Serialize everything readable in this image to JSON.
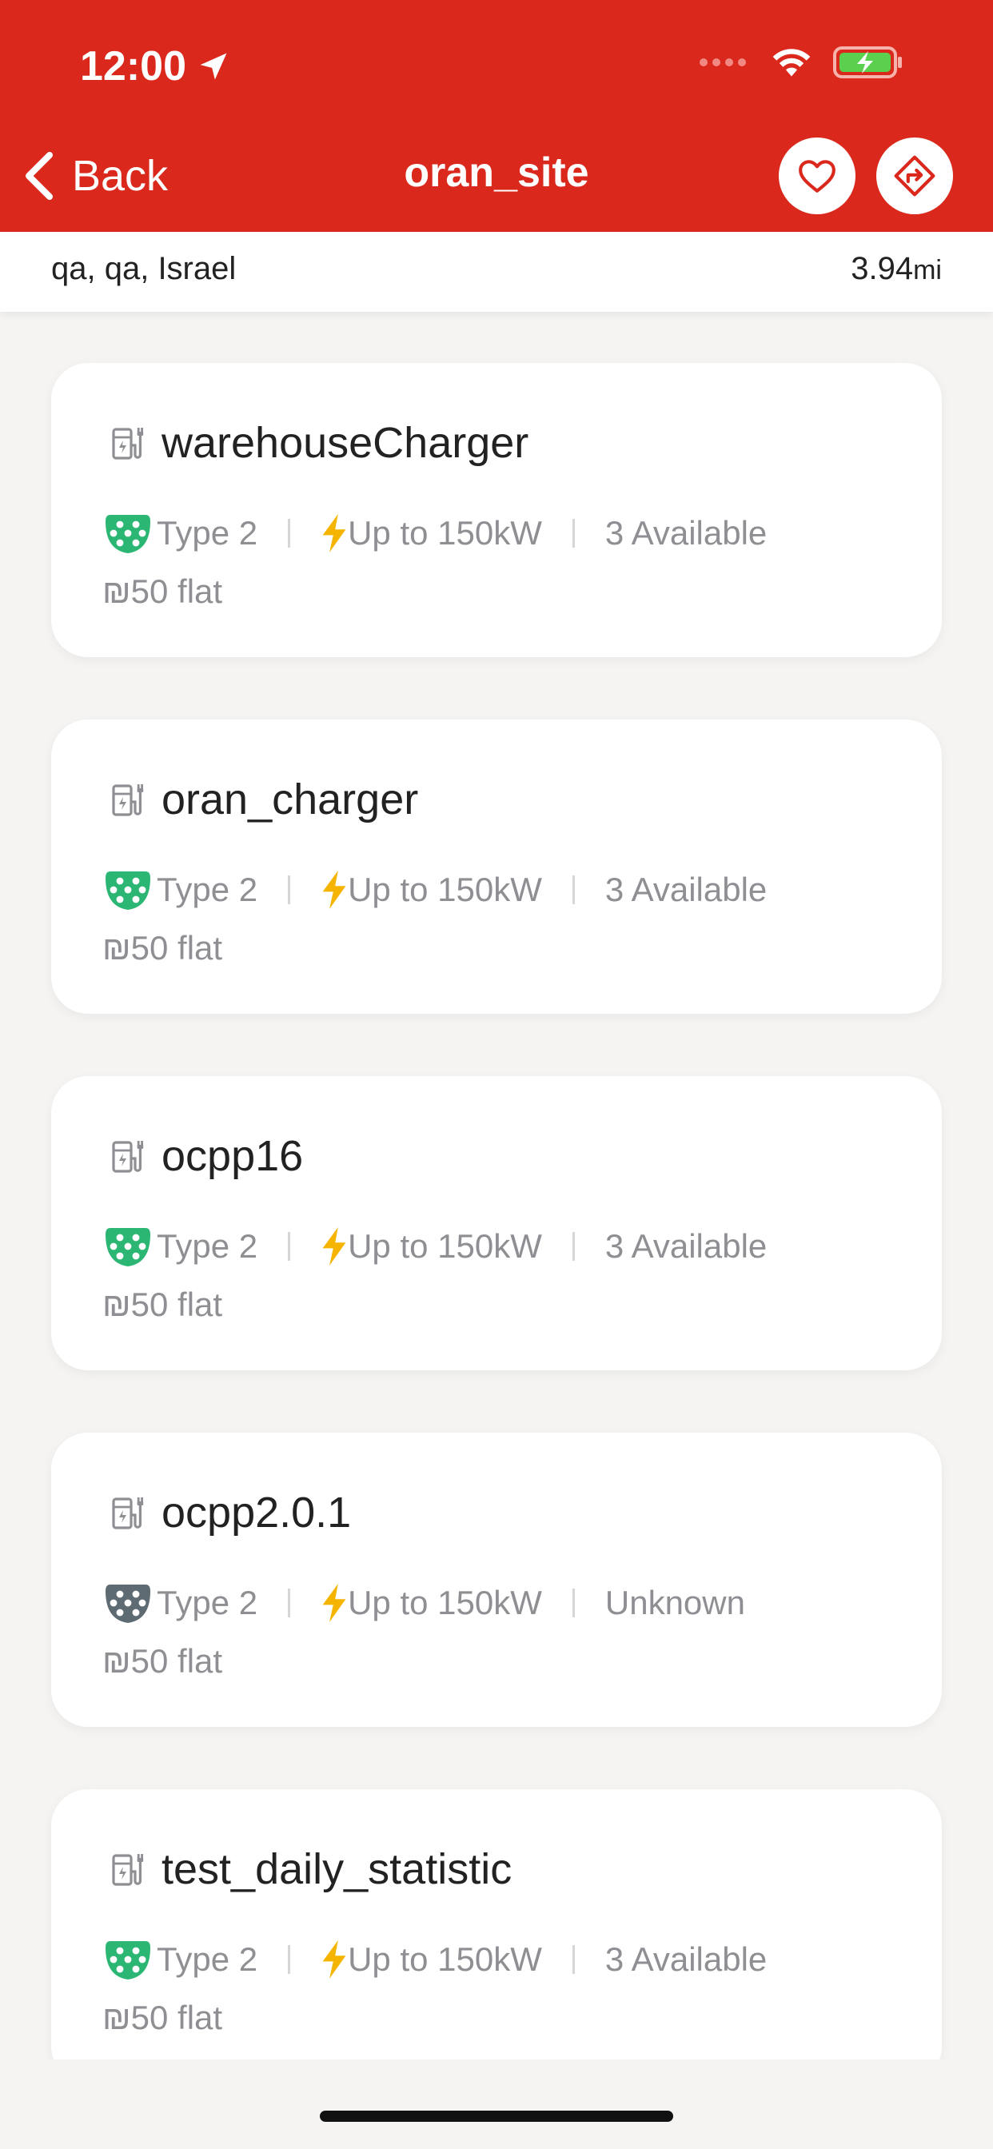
{
  "status_bar": {
    "time": "12:00"
  },
  "nav": {
    "back_label": "Back",
    "title": "oran_site"
  },
  "site": {
    "address": "qa, qa, Israel",
    "distance": "3.94",
    "distance_unit": "mi"
  },
  "colors": {
    "header_red": "#da291c",
    "connector_available": "#2bb673",
    "connector_unknown": "#5f6b73",
    "bolt": "#f5b400"
  },
  "chargers": [
    {
      "name": "warehouseCharger",
      "connector": "Type 2",
      "power": "Up to 150kW",
      "availability": "3 Available",
      "price": "₪50 flat",
      "status": "available"
    },
    {
      "name": "oran_charger",
      "connector": "Type 2",
      "power": "Up to 150kW",
      "availability": "3 Available",
      "price": "₪50 flat",
      "status": "available"
    },
    {
      "name": "ocpp16",
      "connector": "Type 2",
      "power": "Up to 150kW",
      "availability": "3 Available",
      "price": "₪50 flat",
      "status": "available"
    },
    {
      "name": "ocpp2.0.1",
      "connector": "Type 2",
      "power": "Up to 150kW",
      "availability": "Unknown",
      "price": "₪50 flat",
      "status": "unknown"
    },
    {
      "name": "test_daily_statistic",
      "connector": "Type 2",
      "power": "Up to 150kW",
      "availability": "3 Available",
      "price": "₪50 flat",
      "status": "available"
    }
  ]
}
